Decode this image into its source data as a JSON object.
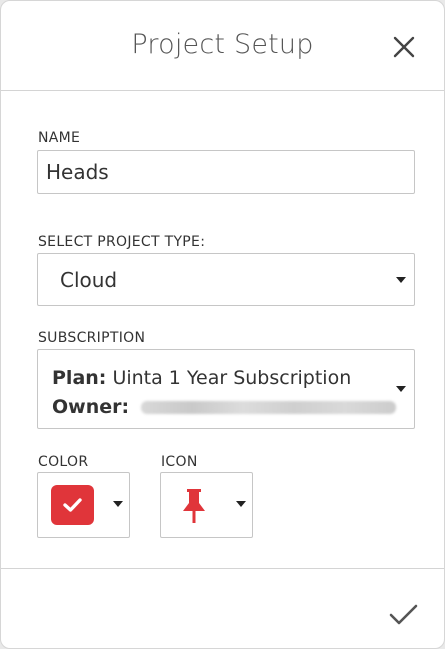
{
  "dialog": {
    "title": "Project Setup",
    "close_icon": "close-icon",
    "confirm_icon": "checkmark-icon"
  },
  "name_field": {
    "label": "NAME",
    "value": "Heads"
  },
  "project_type": {
    "label": "SELECT PROJECT TYPE:",
    "selected": "Cloud"
  },
  "subscription": {
    "label": "SUBSCRIPTION",
    "plan_label": "Plan:",
    "plan_value": "Uinta 1 Year Subscription",
    "owner_label": "Owner:"
  },
  "color_picker": {
    "label": "COLOR",
    "selected_color": "#e0353a"
  },
  "icon_picker": {
    "label": "ICON",
    "selected_icon": "pushpin-icon",
    "icon_color": "#e0353a"
  }
}
